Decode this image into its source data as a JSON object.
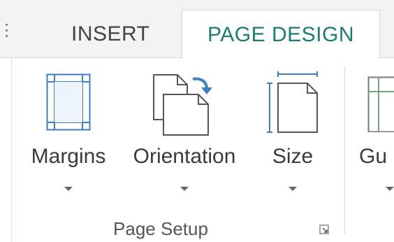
{
  "tabs": {
    "insert_label": "INSERT",
    "page_design_label": "PAGE DESIGN",
    "active": "PAGE DESIGN"
  },
  "page_setup": {
    "group_label": "Page Setup",
    "margins_label": "Margins",
    "orientation_label": "Orientation",
    "size_label": "Size",
    "guides_label": "Gu"
  },
  "icons": {
    "margins": "margins-icon",
    "orientation": "orientation-icon",
    "size": "size-icon",
    "guides": "guides-icon",
    "dialog_launcher": "dialog-launcher-icon"
  },
  "colors": {
    "active_tab_text": "#1e7a74",
    "icon_blue": "#3f7fc1",
    "guides_green": "#6fa878"
  }
}
